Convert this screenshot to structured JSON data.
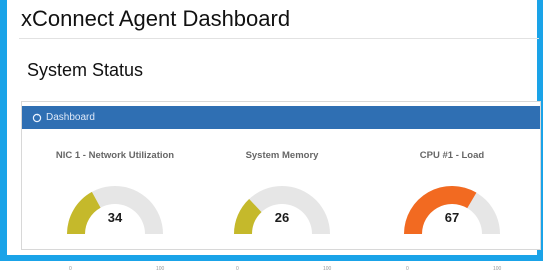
{
  "window": {
    "title": "xConnect Agent Dashboard"
  },
  "section": {
    "title": "System Status"
  },
  "panel": {
    "header_label": "Dashboard",
    "header_icon": "refresh-icon"
  },
  "colors": {
    "frame_accent": "#1aa3e8",
    "panel_header": "#2f6fb3",
    "gauge_track": "#e6e6e6",
    "gauge_low": "#c5b92b",
    "gauge_high": "#f26a21"
  },
  "gauges": [
    {
      "label": "NIC 1 - Network Utilization",
      "value": "34",
      "min": "0",
      "max": "100",
      "fill_percent": 34,
      "color": "#c5b92b"
    },
    {
      "label": "System Memory",
      "value": "26",
      "min": "0",
      "max": "100",
      "fill_percent": 26,
      "color": "#c5b92b"
    },
    {
      "label": "CPU #1 - Load",
      "value": "67",
      "min": "0",
      "max": "100",
      "fill_percent": 67,
      "color": "#f26a21"
    }
  ]
}
